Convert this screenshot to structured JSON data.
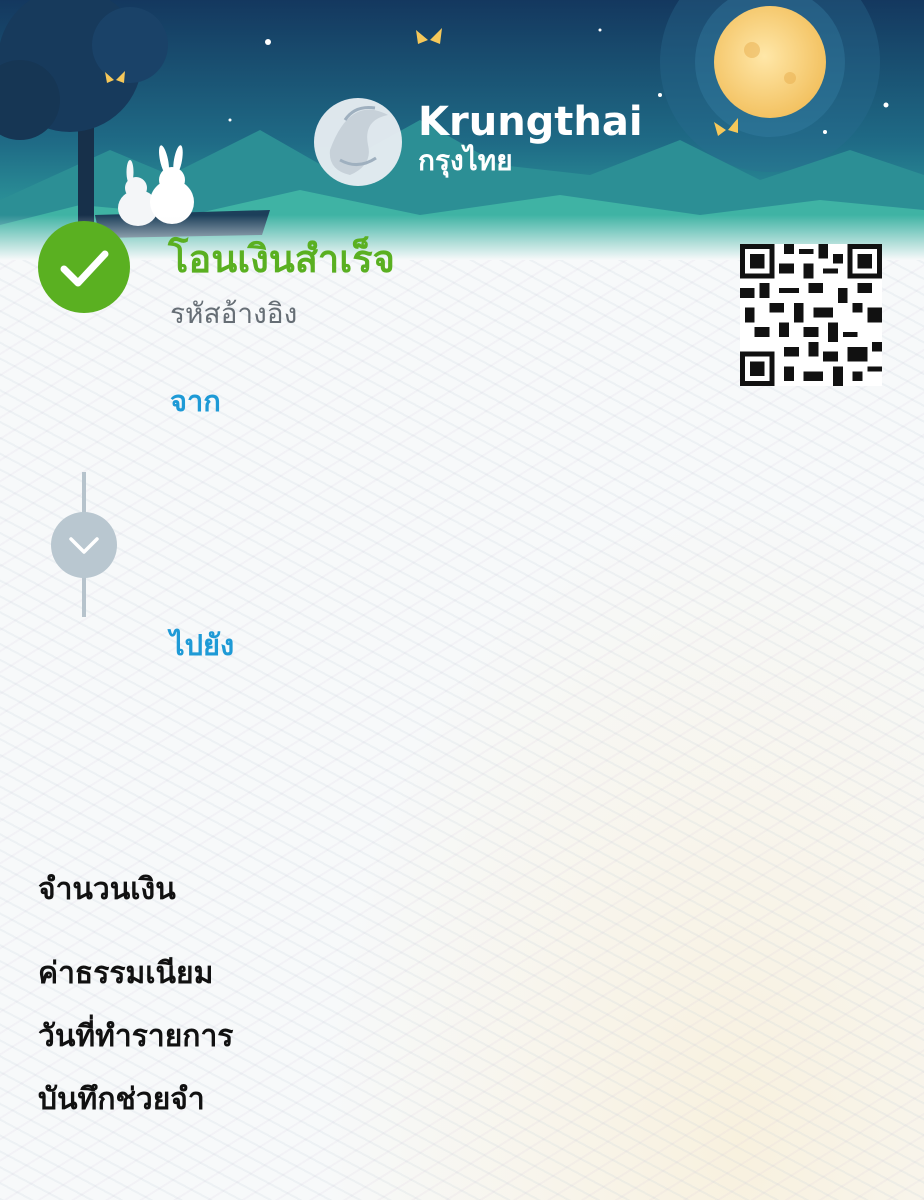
{
  "header": {
    "brand_en": "Krungthai",
    "brand_th": "กรุงไทย"
  },
  "status": {
    "title": "โอนเงินสำเร็จ",
    "reference_label": "รหัสอ้างอิง",
    "icon": "check-circle-icon",
    "color": "#5ab021"
  },
  "transfer": {
    "from_label": "จาก",
    "to_label": "ไปยัง",
    "label_color": "#1e9ad6",
    "connector_icon": "chevron-down-icon"
  },
  "details": {
    "amount_label": "จำนวนเงิน",
    "fee_label": "ค่าธรรมเนียม",
    "date_label": "วันที่ทำรายการ",
    "memo_label": "บันทึกช่วยจำ"
  },
  "qr": {
    "icon": "qr-code-icon"
  }
}
